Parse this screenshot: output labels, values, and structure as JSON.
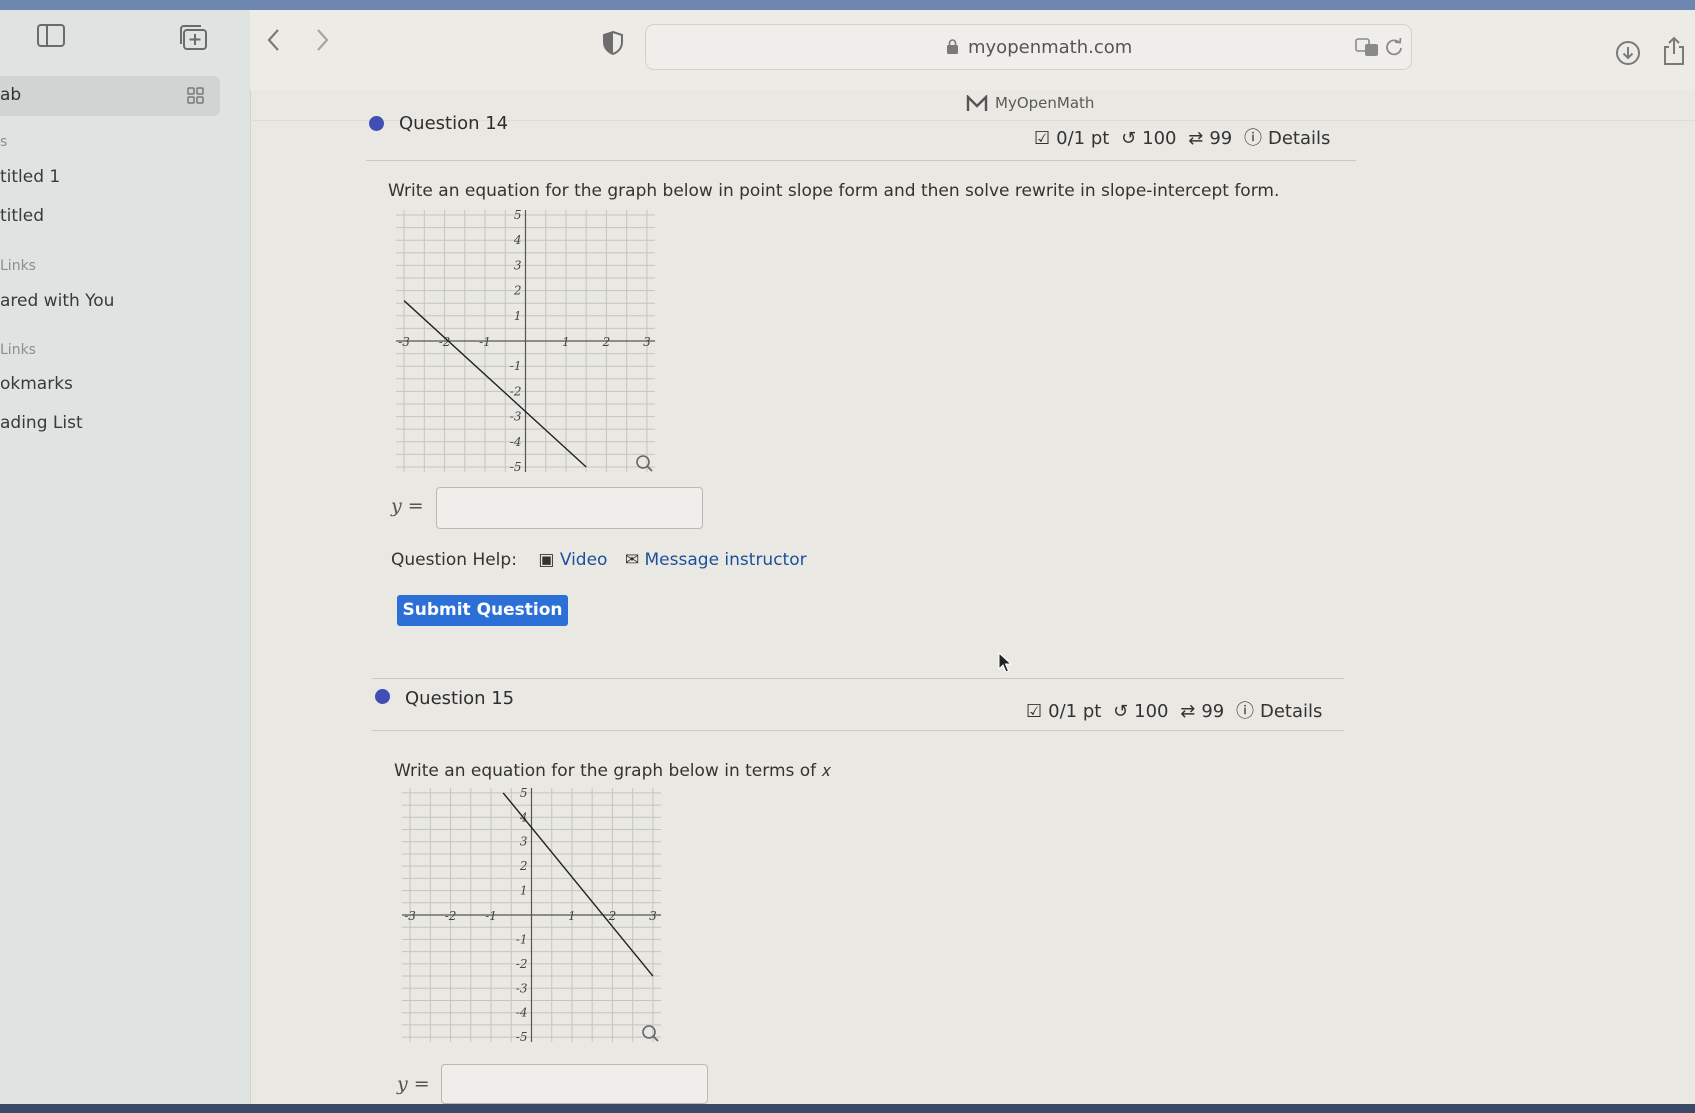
{
  "browser": {
    "url": "myopenmath.com",
    "site_title": "MyOpenMath"
  },
  "sidebar": {
    "tab_label": "ab",
    "items": [
      {
        "kind": "section",
        "label": "s"
      },
      {
        "kind": "item",
        "label": "titled 1"
      },
      {
        "kind": "item",
        "label": "titled"
      },
      {
        "kind": "section",
        "label": "Links"
      },
      {
        "kind": "item",
        "label": "ared with You"
      },
      {
        "kind": "section",
        "label": "Links"
      },
      {
        "kind": "item",
        "label": "okmarks"
      },
      {
        "kind": "item",
        "label": "ading List"
      }
    ]
  },
  "questions": [
    {
      "title": "Question 14",
      "points": "0/1 pt",
      "retries": "100",
      "attempts": "99",
      "details": "Details",
      "prompt": "Write an equation for the graph below in point slope form and then solve rewrite in slope-intercept form.",
      "graph": {
        "x_ticks": [
          "-3",
          "-2",
          "-1",
          "1",
          "2",
          "3"
        ],
        "y_ticks": [
          "5",
          "4",
          "3",
          "2",
          "1",
          "-1",
          "-2",
          "-3",
          "-4",
          "-5"
        ],
        "line_points": [
          [
            -3,
            1.6
          ],
          [
            1.5,
            -5
          ]
        ]
      },
      "answer_label": "y =",
      "help_label": "Question Help:",
      "help_video": "Video",
      "help_message": "Message instructor",
      "submit_label": "Submit Question"
    },
    {
      "title": "Question 15",
      "points": "0/1 pt",
      "retries": "100",
      "attempts": "99",
      "details": "Details",
      "prompt": "Write an equation for the graph below in terms of 𝑥",
      "graph": {
        "x_ticks": [
          "-3",
          "-2",
          "-1",
          "1",
          "2",
          "3"
        ],
        "y_ticks": [
          "5",
          "4",
          "3",
          "2",
          "1",
          "-1",
          "-2",
          "-3",
          "-4",
          "-5"
        ],
        "line_points": [
          [
            -0.7,
            5
          ],
          [
            3,
            -2.5
          ]
        ]
      },
      "answer_label": "y ="
    }
  ]
}
